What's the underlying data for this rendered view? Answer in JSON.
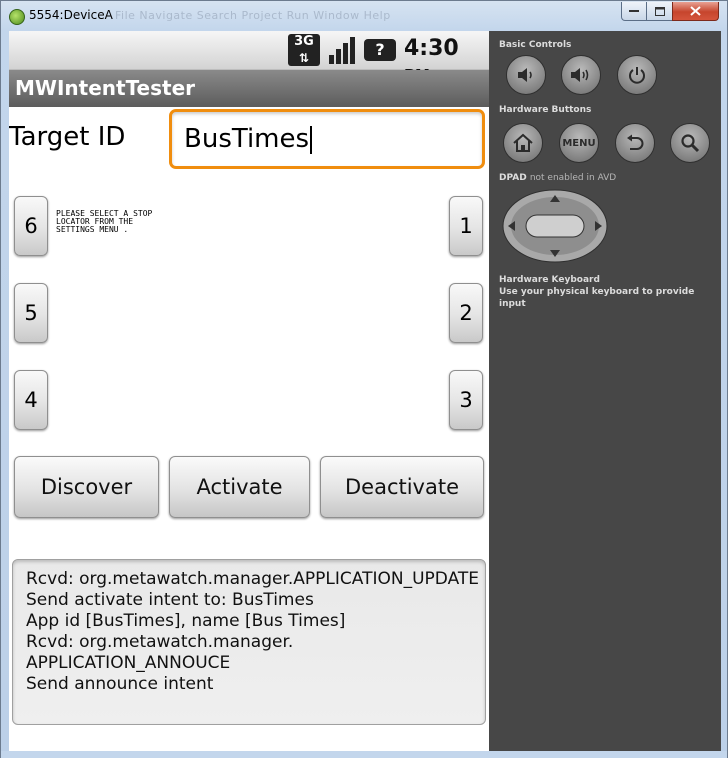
{
  "window": {
    "title": "5554:DeviceA",
    "ghost_menu": "File   Navigate   Search   Project   Run   Window   Help",
    "controls": [
      "minimize",
      "maximize",
      "close"
    ]
  },
  "status_bar": {
    "network": "3G",
    "battery_glyph": "?",
    "time": "4:30",
    "ampm": "PM"
  },
  "app": {
    "title": "MWIntentTester",
    "target_label": "Target ID",
    "target_value": "BusTimes",
    "hint": "PLEASE SELECT A STOP LOCATOR FROM THE SETTINGS MENU .",
    "number_buttons": {
      "b6": "6",
      "b5": "5",
      "b4": "4",
      "b1": "1",
      "b2": "2",
      "b3": "3"
    },
    "actions": {
      "discover": "Discover",
      "activate": "Activate",
      "deactivate": "Deactivate"
    },
    "log": [
      "Rcvd: org.metawatch.manager.APPLICATION_UPDATE",
      "Send activate intent to: BusTimes",
      "App id [BusTimes], name [Bus Times]",
      "Rcvd: org.metawatch.manager.",
      "APPLICATION_ANNOUCE",
      "Send announce intent"
    ]
  },
  "emulator_panel": {
    "basic_controls_label": "Basic Controls",
    "hardware_buttons_label": "Hardware Buttons",
    "dpad_label": "DPAD",
    "dpad_note": "not enabled in AVD",
    "keyboard_label": "Hardware Keyboard",
    "keyboard_note": "Use your physical keyboard to provide input",
    "menu_label": "MENU",
    "basic_icons": [
      "volume-down-icon",
      "volume-up-icon",
      "power-icon"
    ],
    "hardware_icons": [
      "home-icon",
      "menu-icon",
      "back-icon",
      "search-icon"
    ]
  }
}
